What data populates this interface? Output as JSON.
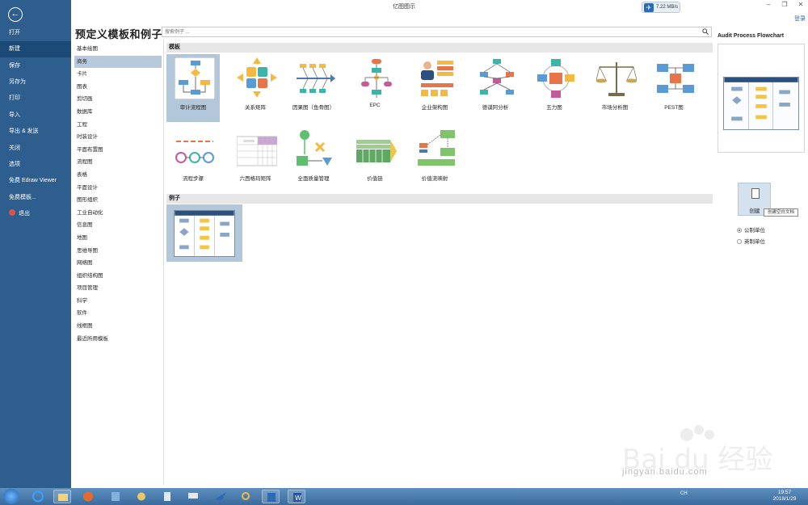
{
  "window": {
    "title": "亿图图示",
    "speed": "7.22 MB/s",
    "login": "登录"
  },
  "backstage": {
    "items": [
      {
        "label": "打开"
      },
      {
        "label": "新建",
        "active": true
      },
      {
        "label": "保存"
      },
      {
        "label": "另存为"
      },
      {
        "label": "打印"
      },
      {
        "label": "导入"
      },
      {
        "label": "导出 & 发送"
      },
      {
        "label": "关闭"
      },
      {
        "label": "选项"
      },
      {
        "label": "免费 Edraw Viewer"
      },
      {
        "label": "免费模板..."
      },
      {
        "label": "退出"
      }
    ]
  },
  "main": {
    "heading": "预定义模板和例子",
    "search_placeholder": "搜索例子 ...",
    "categories": [
      "基本绘图",
      "商务",
      "卡片",
      "图表",
      "剪切画",
      "数据库",
      "工程",
      "时装设计",
      "平面布置图",
      "流程图",
      "表格",
      "平面设计",
      "图形组织",
      "工业自动化",
      "信息图",
      "地图",
      "思维导图",
      "网络图",
      "组织结构图",
      "项目管理",
      "科学",
      "软件",
      "线框图",
      "最近所用模板"
    ],
    "active_category": 1,
    "templates_header": "模板",
    "templates": [
      "审计流程图",
      "关系矩阵",
      "因果图（鱼骨图）",
      "EPC",
      "企业架构图",
      "德谟阿分析",
      "五力图",
      "市场分析图",
      "PEST图",
      "流程步骤",
      "六西格玛矩阵",
      "全面质量管理",
      "价值链",
      "价值流映射"
    ],
    "examples_header": "例子"
  },
  "right_panel": {
    "title": "Audit Process Flowchart",
    "create_label": "创建",
    "tooltip": "创建空白文档",
    "units": [
      {
        "label": "公制单位",
        "checked": true
      },
      {
        "label": "英制单位",
        "checked": false
      }
    ]
  },
  "taskbar": {
    "tray_text": "CH",
    "time": "19:57",
    "date": "2018/1/29"
  },
  "watermark": {
    "text": "jingyan.baidu.com"
  },
  "colors": {
    "sidebar": "#2e5e8e",
    "selected_tile": "#b3c7db",
    "accent": "#2b6bb5"
  }
}
